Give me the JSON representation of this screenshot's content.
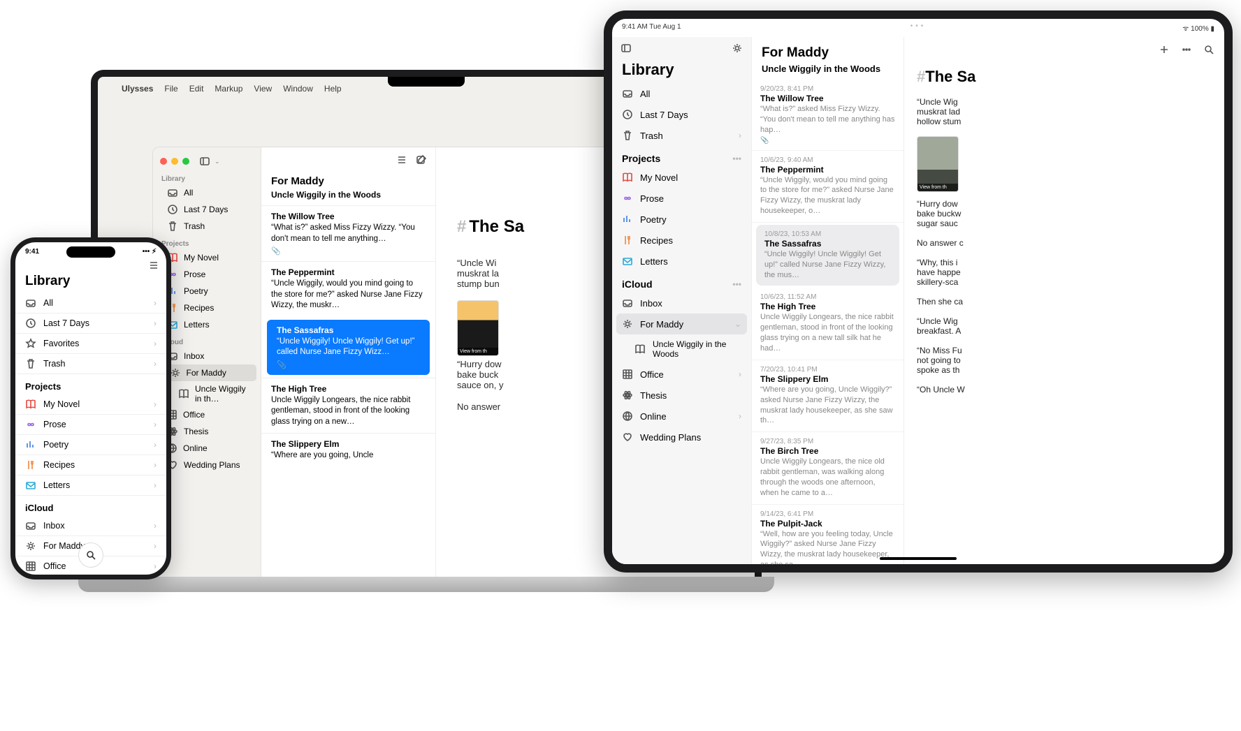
{
  "iphone": {
    "time": "9:41",
    "title": "Library",
    "sections": {
      "top": [
        "All",
        "Last 7 Days",
        "Favorites",
        "Trash"
      ],
      "projects_label": "Projects",
      "projects": [
        "My Novel",
        "Prose",
        "Poetry",
        "Recipes",
        "Letters"
      ],
      "icloud_label": "iCloud",
      "icloud": [
        "Inbox",
        "For Maddy",
        "Office"
      ]
    }
  },
  "mac": {
    "menubar": [
      "Ulysses",
      "File",
      "Edit",
      "Markup",
      "View",
      "Window",
      "Help"
    ],
    "sidebar": {
      "library_label": "Library",
      "library": [
        "All",
        "Last 7 Days",
        "Trash"
      ],
      "projects_label": "Projects",
      "projects": [
        "My Novel",
        "Prose",
        "Poetry",
        "Recipes",
        "Letters"
      ],
      "icloud_label": "iCloud",
      "inbox": "Inbox",
      "for_maddy": "For Maddy",
      "uncle": "Uncle Wiggily in th…",
      "office": "Office",
      "thesis": "Thesis",
      "online": "Online",
      "wedding": "Wedding Plans"
    },
    "list": {
      "title": "For Maddy",
      "subtitle": "Uncle Wiggily in the Woods",
      "s1t": "The Willow Tree",
      "s1p": "“What is?” asked Miss Fizzy Wizzy. “You don't mean to tell me anything…",
      "s2t": "The Peppermint",
      "s2p": "“Uncle Wiggily, would you mind going to the store for me?” asked Nurse Jane Fizzy Wizzy, the muskr…",
      "s3t": "The Sassafras",
      "s3p": "“Uncle Wiggily! Uncle Wiggily! Get up!” called Nurse Jane Fizzy Wizz…",
      "s4t": "The High Tree",
      "s4p": "Uncle Wiggily Longears, the nice rabbit gentleman, stood in front of the looking glass trying on a new…",
      "s5t": "The Slippery Elm",
      "s5p": "“Where are you going, Uncle"
    },
    "editor": {
      "h1": "The Sa",
      "p1": "“Uncle Wi\nmuskrat la\nstump bun",
      "image_caption": "View from th",
      "p2": "“Hurry dow\nbake buck\nsauce on, y",
      "p3": "No answer"
    }
  },
  "ipad": {
    "status_left": "9:41 AM   Tue Aug 1",
    "status_right": "100%",
    "sidebar": {
      "title": "Library",
      "top": [
        "All",
        "Last 7 Days",
        "Trash"
      ],
      "projects_label": "Projects",
      "projects": [
        "My Novel",
        "Prose",
        "Poetry",
        "Recipes",
        "Letters"
      ],
      "icloud_label": "iCloud",
      "inbox": "Inbox",
      "for_maddy": "For Maddy",
      "uncle": "Uncle Wiggily in the Woods",
      "office": "Office",
      "thesis": "Thesis",
      "online": "Online",
      "wedding": "Wedding Plans"
    },
    "list": {
      "title": "For Maddy",
      "subtitle": "Uncle Wiggily in the Woods",
      "d1": "9/20/23, 8:41 PM",
      "t1": "The Willow Tree",
      "p1": "“What is?” asked Miss Fizzy Wizzy. “You don't mean to tell me anything has hap…",
      "d2": "10/6/23, 9:40 AM",
      "t2": "The Peppermint",
      "p2": "“Uncle Wiggily, would you mind going to the store for me?” asked Nurse Jane Fizzy Wizzy, the muskrat lady housekeeper, o…",
      "d3": "10/8/23, 10:53 AM",
      "t3": "The Sassafras",
      "p3": "“Uncle Wiggily! Uncle Wiggily! Get up!” called Nurse Jane Fizzy Wizzy, the mus…",
      "d4": "10/6/23, 11:52 AM",
      "t4": "The High Tree",
      "p4": "Uncle Wiggily Longears, the nice rabbit gentleman, stood in front of the looking glass trying on a new tall silk hat he had…",
      "d5": "7/20/23, 10:41 PM",
      "t5": "The Slippery Elm",
      "p5": "“Where are you going, Uncle Wiggily?” asked Nurse Jane Fizzy Wizzy, the muskrat lady housekeeper, as she saw th…",
      "d6": "9/27/23, 8:35 PM",
      "t6": "The Birch Tree",
      "p6": "Uncle Wiggily Longears, the nice old rabbit gentleman, was walking along through the woods one afternoon, when he came to a…",
      "d7": "9/14/23, 6:41 PM",
      "t7": "The Pulpit-Jack",
      "p7": "“Well, how are you feeling today, Uncle Wiggily?” asked Nurse Jane Fizzy Wizzy, the muskrat lady housekeeper, as she sa…"
    },
    "editor": {
      "h1": "The Sa",
      "p1": "“Uncle Wig\nmuskrat lad\nhollow stum",
      "image_caption": "View from th",
      "p2": "“Hurry dow\nbake buckw\nsugar sauc",
      "p3": "No answer c",
      "p4": "“Why, this i\nhave happe\nskillery-sca",
      "p5": "Then she ca",
      "p6": "“Uncle Wig\nbreakfast. A",
      "p7": "“No Miss Fu\nnot going to\nspoke as th",
      "p8": "“Oh Uncle W"
    }
  },
  "attachment_glyph": "📎"
}
